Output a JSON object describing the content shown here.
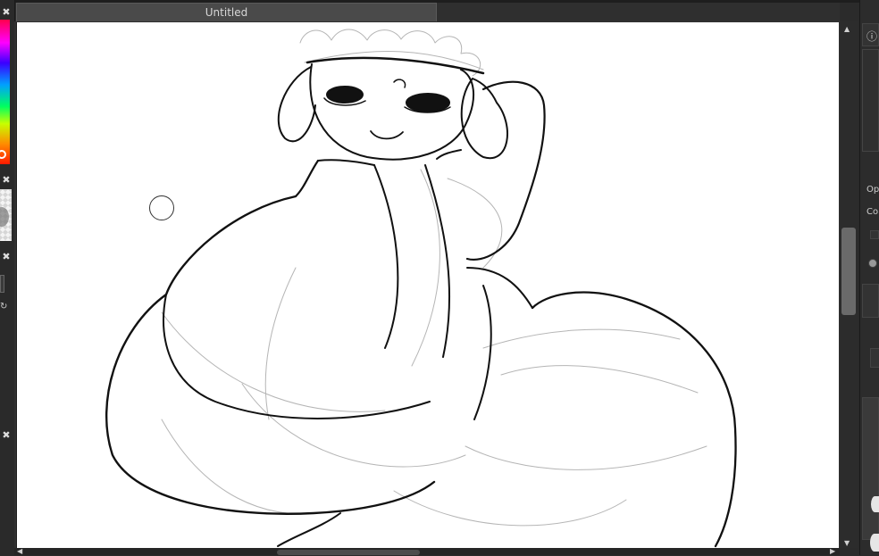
{
  "document": {
    "tab_title": "Untitled"
  },
  "left_panel": {
    "close_symbol": "✖",
    "glyph": "↻"
  },
  "right_panel": {
    "label_1": "Op",
    "label_2": "Co",
    "info_icon": "ⓘ"
  },
  "icons": {
    "scroll_up": "▲",
    "scroll_down": "▼",
    "scroll_left": "◀",
    "scroll_right": "▶"
  }
}
